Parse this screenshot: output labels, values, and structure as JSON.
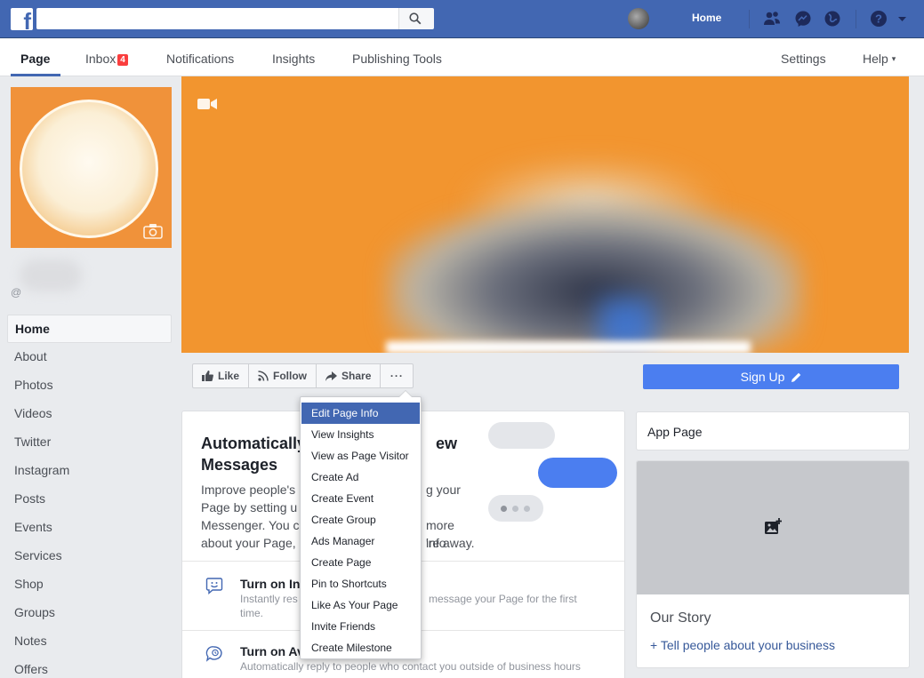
{
  "topbar": {
    "search_placeholder": "",
    "home_label": "Home"
  },
  "pagenav": {
    "tabs": [
      {
        "label": "Page"
      },
      {
        "label": "Inbox",
        "badge": "4"
      },
      {
        "label": "Notifications"
      },
      {
        "label": "Insights"
      },
      {
        "label": "Publishing Tools"
      }
    ],
    "settings_label": "Settings",
    "help_label": "Help"
  },
  "profile": {
    "handle": "@"
  },
  "sidebar": {
    "items": [
      {
        "label": "Home"
      },
      {
        "label": "About"
      },
      {
        "label": "Photos"
      },
      {
        "label": "Videos"
      },
      {
        "label": "Twitter"
      },
      {
        "label": "Instagram"
      },
      {
        "label": "Posts"
      },
      {
        "label": "Events"
      },
      {
        "label": "Services"
      },
      {
        "label": "Shop"
      },
      {
        "label": "Groups"
      },
      {
        "label": "Notes"
      },
      {
        "label": "Offers"
      }
    ]
  },
  "actions": {
    "like_label": "Like",
    "follow_label": "Follow",
    "share_label": "Share",
    "more_label": "···",
    "signup_label": "Sign Up"
  },
  "dropdown": {
    "items": [
      {
        "label": "Edit Page Info"
      },
      {
        "label": "View Insights"
      },
      {
        "label": "View as Page Visitor"
      },
      {
        "label": "Create Ad"
      },
      {
        "label": "Create Event"
      },
      {
        "label": "Create Group"
      },
      {
        "label": "Ads Manager"
      },
      {
        "label": "Create Page"
      },
      {
        "label": "Pin to Shortcuts"
      },
      {
        "label": "Like As Your Page"
      },
      {
        "label": "Invite Friends"
      },
      {
        "label": "Create Milestone"
      }
    ]
  },
  "promo": {
    "title_line1": "Automatically",
    "title_tail1": "ew",
    "title_line2": "Messages",
    "text_lines": [
      {
        "left": "Improve people's",
        "right": "g your"
      },
      {
        "left": "Page by setting u",
        "right": ""
      },
      {
        "left": "Messenger. You c",
        "right": "more info"
      },
      {
        "left": "about your Page,",
        "right": "'re away."
      }
    ]
  },
  "features": [
    {
      "title": "Turn on In",
      "desc_left": "Instantly res",
      "desc_right": "message your Page for the first",
      "desc_line2": "time."
    },
    {
      "title": "Turn on Av",
      "desc_left": "Automatically reply to people who contact you outside of business hours",
      "desc_right": "",
      "desc_line2": ""
    }
  ],
  "right": {
    "app_page_label": "App Page",
    "story_title": "Our Story",
    "story_link": "+ Tell people about your business"
  },
  "colors": {
    "brand_blue": "#4267b2",
    "cover_orange": "#f2952f",
    "signup_blue": "#4b7ef0",
    "badge_red": "#fa3e3e"
  }
}
